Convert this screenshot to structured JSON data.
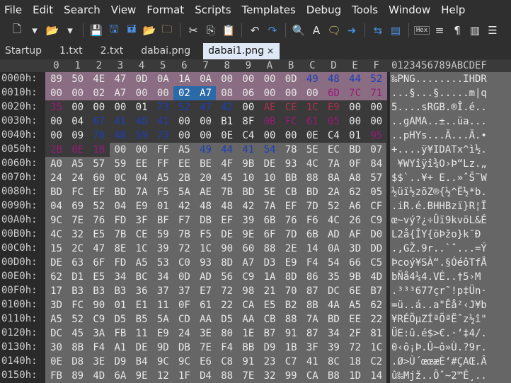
{
  "menu": [
    "File",
    "Edit",
    "Search",
    "View",
    "Format",
    "Scripts",
    "Templates",
    "Debug",
    "Tools",
    "Window",
    "Help"
  ],
  "toolbar_icons": [
    "new-file-icon",
    "chevron-down-icon",
    "open-folder-icon",
    "chevron-down-icon",
    "save-icon",
    "save-as-icon",
    "save-all-icon",
    "open-folder-icon",
    "folder-icon",
    "cut-icon",
    "copy-icon",
    "paste-icon",
    "undo-icon",
    "redo-icon",
    "find-icon",
    "replace-icon",
    "find-in-files-icon",
    "goto-icon",
    "compare-icon",
    "templates-icon",
    "hex-icon",
    "text-format-icon",
    "paragraph-icon",
    "columns-icon",
    "list-icon"
  ],
  "tabs": [
    {
      "label": "Startup",
      "active": false
    },
    {
      "label": "1.txt",
      "active": false
    },
    {
      "label": "2.txt",
      "active": false
    },
    {
      "label": "dabai.png",
      "active": false
    },
    {
      "label": "dabai1.png",
      "active": true,
      "close": "×"
    }
  ],
  "hex": {
    "columns": [
      "0",
      "1",
      "2",
      "3",
      "4",
      "5",
      "6",
      "7",
      "8",
      "9",
      "A",
      "B",
      "C",
      "D",
      "E",
      "F"
    ],
    "ascii_header": "0123456789ABCDEF",
    "rows": [
      {
        "addr": "0000h:",
        "bytes": [
          "89",
          "50",
          "4E",
          "47",
          "0D",
          "0A",
          "1A",
          "0A",
          "00",
          "00",
          "00",
          "0D",
          "49",
          "48",
          "44",
          "52"
        ],
        "ascii": "‰PNG........IHDR"
      },
      {
        "addr": "0010h:",
        "bytes": [
          "00",
          "00",
          "02",
          "A7",
          "00",
          "00",
          "02",
          "A7",
          "08",
          "06",
          "00",
          "00",
          "00",
          "6D",
          "7C",
          "71"
        ],
        "ascii": "...§...§.....m|q"
      },
      {
        "addr": "0020h:",
        "bytes": [
          "35",
          "00",
          "00",
          "00",
          "01",
          "73",
          "52",
          "47",
          "42",
          "00",
          "AE",
          "CE",
          "1C",
          "E9",
          "00",
          "00"
        ],
        "ascii": "5....sRGB.®Î.é.."
      },
      {
        "addr": "0030h:",
        "bytes": [
          "00",
          "04",
          "67",
          "41",
          "4D",
          "41",
          "00",
          "00",
          "B1",
          "8F",
          "0B",
          "FC",
          "61",
          "05",
          "00",
          "00"
        ],
        "ascii": "..gAMA..±..üa..."
      },
      {
        "addr": "0040h:",
        "bytes": [
          "00",
          "09",
          "70",
          "48",
          "59",
          "73",
          "00",
          "00",
          "0E",
          "C4",
          "00",
          "00",
          "0E",
          "C4",
          "01",
          "95"
        ],
        "ascii": "..pHYs...Ä...Ä.•"
      },
      {
        "addr": "0050h:",
        "bytes": [
          "2B",
          "0E",
          "1B",
          "00",
          "00",
          "FF",
          "A5",
          "49",
          "44",
          "41",
          "54",
          "78",
          "5E",
          "EC",
          "BD",
          "07"
        ],
        "ascii": "+....ÿ¥IDATx^ì½."
      },
      {
        "addr": "0060h:",
        "bytes": [
          "A0",
          "A5",
          "57",
          "59",
          "EE",
          "FF",
          "EE",
          "BE",
          "4F",
          "9B",
          "DE",
          "93",
          "4C",
          "7A",
          "0F",
          "84"
        ],
        "ascii": " ¥WYîÿî¾O›Þ“Lz.„"
      },
      {
        "addr": "0070h:",
        "bytes": [
          "24",
          "24",
          "60",
          "0C",
          "04",
          "A5",
          "2B",
          "20",
          "45",
          "10",
          "10",
          "BB",
          "88",
          "8A",
          "A8",
          "57"
        ],
        "ascii": "$$`..¥+ E..»ˆŠ¨W"
      },
      {
        "addr": "0080h:",
        "bytes": [
          "BD",
          "FC",
          "EF",
          "BD",
          "7A",
          "F5",
          "5A",
          "AE",
          "7B",
          "BD",
          "5E",
          "CB",
          "BD",
          "2A",
          "62",
          "05"
        ],
        "ascii": "½üï½zõZ®{½^Ë½*b."
      },
      {
        "addr": "0090h:",
        "bytes": [
          "04",
          "69",
          "52",
          "04",
          "E9",
          "01",
          "42",
          "48",
          "48",
          "42",
          "7A",
          "EF",
          "7D",
          "52",
          "A6",
          "CF"
        ],
        "ascii": ".iR.é.BHHBzï}R¦Ï"
      },
      {
        "addr": "00A0h:",
        "bytes": [
          "9C",
          "7E",
          "76",
          "FD",
          "3F",
          "BF",
          "F7",
          "DB",
          "EF",
          "39",
          "6B",
          "76",
          "F6",
          "4C",
          "26",
          "C9"
        ],
        "ascii": "œ~vý?¿÷Ûï9kvöL&É"
      },
      {
        "addr": "00B0h:",
        "bytes": [
          "4C",
          "32",
          "E5",
          "7B",
          "CE",
          "59",
          "7B",
          "F5",
          "DE",
          "9E",
          "6F",
          "7D",
          "6B",
          "AD",
          "AF",
          "D0"
        ],
        "ascii": "L2å{ÎY{õÞžo}k­¯Ð"
      },
      {
        "addr": "00C0h:",
        "bytes": [
          "15",
          "2C",
          "47",
          "8E",
          "1C",
          "39",
          "72",
          "1C",
          "90",
          "60",
          "88",
          "2E",
          "14",
          "0A",
          "3D",
          "DD"
        ],
        "ascii": ".,GŽ.9r..`ˆ...=Ý"
      },
      {
        "addr": "00D0h:",
        "bytes": [
          "DE",
          "63",
          "6F",
          "FD",
          "A5",
          "53",
          "C0",
          "93",
          "8D",
          "A7",
          "D3",
          "E9",
          "F4",
          "54",
          "66",
          "C5"
        ],
        "ascii": "Þcoý¥SÀ“.§ÓéôTfÅ"
      },
      {
        "addr": "00E0h:",
        "bytes": [
          "62",
          "D1",
          "E5",
          "34",
          "BC",
          "34",
          "0D",
          "AD",
          "56",
          "C9",
          "1A",
          "8D",
          "86",
          "35",
          "9B",
          "4D"
        ],
        "ascii": "bÑå4¼4.­VÉ..†5›M"
      },
      {
        "addr": "00F0h:",
        "bytes": [
          "17",
          "B3",
          "B3",
          "B3",
          "36",
          "37",
          "37",
          "E7",
          "72",
          "98",
          "21",
          "70",
          "87",
          "DC",
          "6E",
          "B7"
        ],
        "ascii": ".³³³677çr˜!p‡Ün·"
      },
      {
        "addr": "0100h:",
        "bytes": [
          "3D",
          "FC",
          "90",
          "01",
          "E1",
          "11",
          "0F",
          "61",
          "22",
          "CA",
          "E5",
          "B2",
          "8B",
          "4A",
          "A5",
          "62"
        ],
        "ascii": "=ü..á..a\"Êå²‹J¥b"
      },
      {
        "addr": "0110h:",
        "bytes": [
          "A5",
          "52",
          "C9",
          "D5",
          "B5",
          "5A",
          "CD",
          "AA",
          "D5",
          "AA",
          "CB",
          "88",
          "7A",
          "BD",
          "EE",
          "22"
        ],
        "ascii": "¥RÉÕµZÍªÕªËˆz½î\""
      },
      {
        "addr": "0120h:",
        "bytes": [
          "DC",
          "45",
          "3A",
          "FB",
          "11",
          "E9",
          "24",
          "3E",
          "80",
          "1E",
          "B7",
          "91",
          "87",
          "34",
          "2F",
          "81"
        ],
        "ascii": "ÜE:û.é$>€.·‘‡4/."
      },
      {
        "addr": "0130h:",
        "bytes": [
          "30",
          "8B",
          "F4",
          "A1",
          "DE",
          "9D",
          "DB",
          "7E",
          "F4",
          "BB",
          "D9",
          "1B",
          "3F",
          "39",
          "72",
          "1C"
        ],
        "ascii": "0‹ô¡Þ.Û~ô»Ù.?9r."
      },
      {
        "addr": "0140h:",
        "bytes": [
          "0E",
          "D8",
          "3E",
          "D9",
          "B4",
          "9C",
          "9C",
          "E6",
          "C8",
          "91",
          "23",
          "C7",
          "41",
          "8C",
          "18",
          "C2"
        ],
        "ascii": ".Ø>Ù´œœæÈ‘#ÇAŒ.Â"
      },
      {
        "addr": "0150h:",
        "bytes": [
          "FB",
          "89",
          "4D",
          "6A",
          "9E",
          "12",
          "1F",
          "D4",
          "88",
          "7E",
          "32",
          "99",
          "CA",
          "B8",
          "1D",
          "14"
        ],
        "ascii": "û‰Mjž..Ôˆ~2™Ê¸.."
      }
    ]
  },
  "colors": {
    "accent": "#2b6aa8",
    "highlight": "#8a6d82",
    "grid": "#666666",
    "blue_text": "#1a3fb8",
    "magenta_text": "#9a1a7a"
  }
}
